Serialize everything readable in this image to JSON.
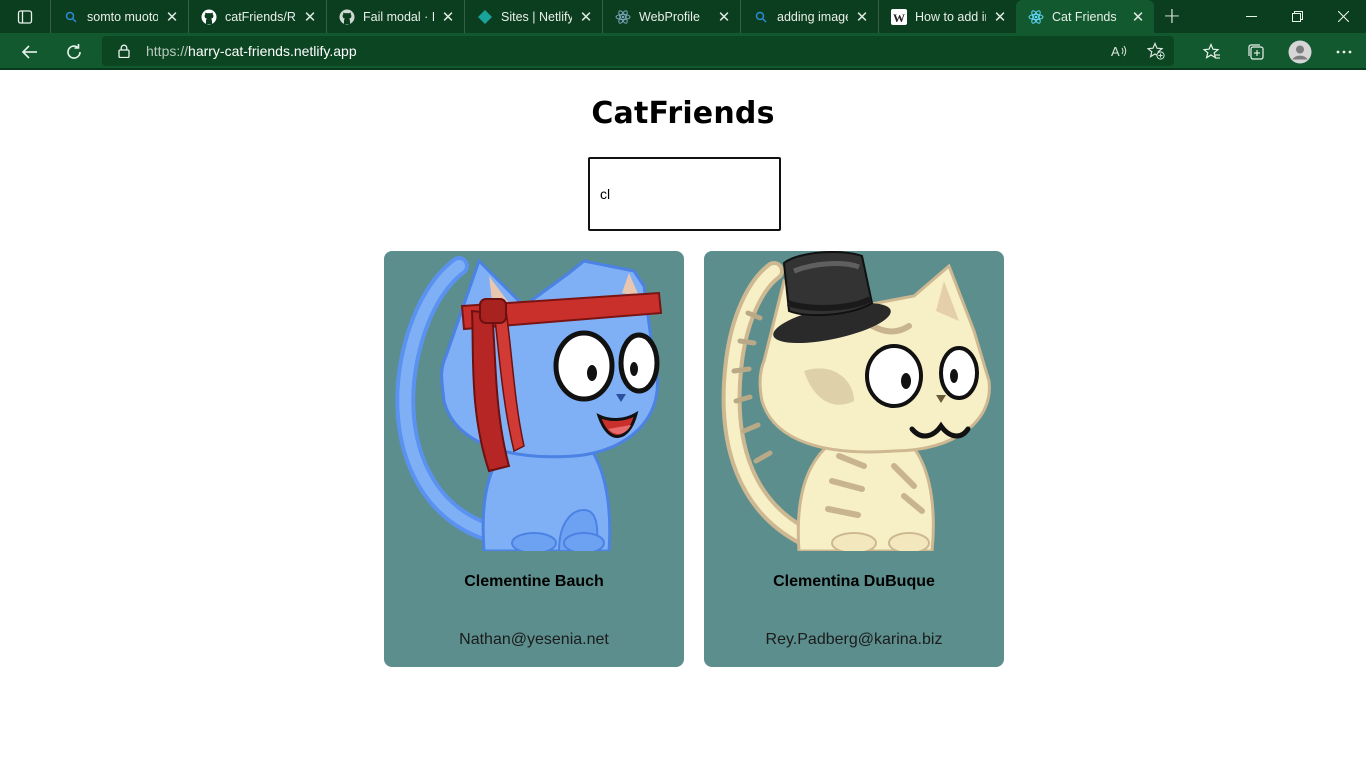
{
  "browser": {
    "tabs": [
      {
        "label": "somto muoto",
        "icon": "search-icon"
      },
      {
        "label": "catFriends/RE",
        "icon": "github-icon"
      },
      {
        "label": "Fail modal · Is",
        "icon": "github-icon"
      },
      {
        "label": "Sites | Netlify",
        "icon": "netlify-icon"
      },
      {
        "label": "WebProfile",
        "icon": "react-icon"
      },
      {
        "label": "adding image",
        "icon": "search-icon"
      },
      {
        "label": "How to add in",
        "icon": "wikihow-icon"
      },
      {
        "label": "Cat Friends",
        "icon": "react-icon",
        "active": true
      }
    ],
    "address": {
      "protocol": "https://",
      "host": "harry-cat-friends.netlify.app"
    },
    "colors": {
      "tabbar": "#0b3d1f",
      "toolbar": "#12592f"
    }
  },
  "page": {
    "title": "CatFriends",
    "search": {
      "value": "cl"
    },
    "cards": [
      {
        "name": "Clementine Bauch",
        "email": "Nathan@yesenia.net",
        "image": "blue-cat-with-red-headband"
      },
      {
        "name": "Clementina DuBuque",
        "email": "Rey.Padberg@karina.biz",
        "image": "cream-tabby-cat-with-top-hat"
      }
    ],
    "colors": {
      "card": "#5b8e8c"
    }
  }
}
